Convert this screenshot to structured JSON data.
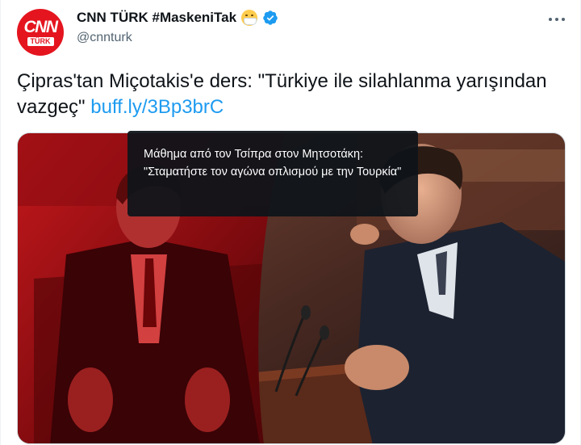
{
  "author": {
    "name": "CNN TÜRK #MaskeniTak",
    "handle": "@cnnturk",
    "avatar": {
      "logo_text": "CNN",
      "logo_subtext": "TÜRK"
    },
    "icons": [
      "face-with-medical-mask-icon",
      "verified-badge-icon"
    ]
  },
  "menu": {
    "icon": "more-options-icon"
  },
  "tweet": {
    "text": "Çipras'tan Miçotakis'e ders: \"Türkiye ile silahlanma yarışından vazgeç\"",
    "link_text": "buff.ly/3Bp3brC"
  },
  "media": {
    "alt_text": "Μάθημα από τον Τσίπρα στον Μητσοτάκη: \"Σταματήστε τον αγώνα οπλισμού με την Τουρκία\""
  },
  "colors": {
    "accent_link": "#1d9bf0",
    "verified": "#1d9bf0",
    "brand_red": "#e4151f",
    "tooltip_bg": "#0f1419",
    "secondary_text": "#536471"
  }
}
